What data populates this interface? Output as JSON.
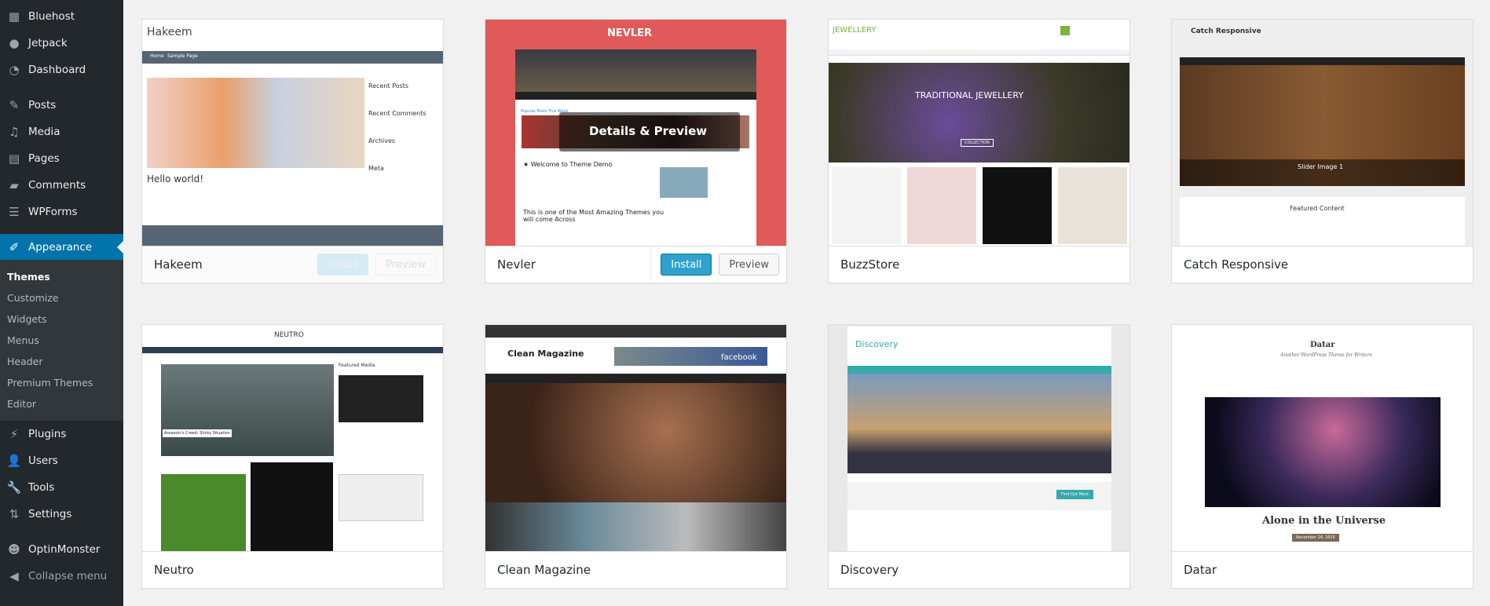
{
  "sidebar": {
    "items": [
      {
        "label": "Bluehost",
        "icon": "grid-icon"
      },
      {
        "label": "Jetpack",
        "icon": "jetpack-icon"
      },
      {
        "label": "Dashboard",
        "icon": "dashboard-icon"
      },
      {
        "label": "Posts",
        "icon": "pin-icon"
      },
      {
        "label": "Media",
        "icon": "media-icon"
      },
      {
        "label": "Pages",
        "icon": "pages-icon"
      },
      {
        "label": "Comments",
        "icon": "comment-icon"
      },
      {
        "label": "WPForms",
        "icon": "forms-icon"
      },
      {
        "label": "Appearance",
        "icon": "brush-icon",
        "active": true
      },
      {
        "label": "Plugins",
        "icon": "plug-icon"
      },
      {
        "label": "Users",
        "icon": "user-icon"
      },
      {
        "label": "Tools",
        "icon": "wrench-icon"
      },
      {
        "label": "Settings",
        "icon": "settings-icon"
      },
      {
        "label": "OptinMonster",
        "icon": "monster-icon"
      },
      {
        "label": "Collapse menu",
        "icon": "collapse-icon"
      }
    ],
    "submenu": [
      "Themes",
      "Customize",
      "Widgets",
      "Menus",
      "Header",
      "Premium Themes",
      "Editor"
    ]
  },
  "colors": {
    "accent": "#0073aa",
    "sidebar": "#23282d",
    "install": "#2ea2cc",
    "nevler": "#e05a5a"
  },
  "buttons": {
    "install": "Install",
    "preview": "Preview"
  },
  "themes": [
    {
      "name": "Hakeem",
      "preview": {
        "title": "Hakeem",
        "nav": [
          "Home",
          "Sample Page"
        ],
        "widgets": [
          "Recent Posts",
          "Recent Comments",
          "Archives",
          "Meta"
        ],
        "post": "Hello world!"
      }
    },
    {
      "name": "Nevler",
      "preview": {
        "title": "NEVLER",
        "overlay": "Details & Preview",
        "post1": "★ Welcome to Theme Demo",
        "post2": "This is one of the Most Amazing Themes you will come Across",
        "section": "Popular Posts This Week"
      }
    },
    {
      "name": "BuzzStore",
      "preview": {
        "title": "JEWELLERY",
        "banner": "TRADITIONAL JEWELLERY",
        "cta": "COLLECTION"
      }
    },
    {
      "name": "Catch Responsive",
      "preview": {
        "title": "Catch Responsive",
        "slider": "Slider Image 1",
        "featured": "Featured Content"
      }
    },
    {
      "name": "Neutro",
      "preview": {
        "title": "NEUTRO",
        "featured": "Featured Media",
        "caption": "Assassin's Creed: Sticky Situation"
      }
    },
    {
      "name": "Clean Magazine",
      "preview": {
        "title": "Clean Magazine",
        "ad": "facebook"
      }
    },
    {
      "name": "Discovery",
      "preview": {
        "title": "Discovery",
        "button": "Find Out More"
      }
    },
    {
      "name": "Datar",
      "preview": {
        "title": "Datar",
        "tagline": "Another WordPress Theme for Writers",
        "post": "Alone in the Universe",
        "date": "November 24, 2015"
      }
    }
  ]
}
